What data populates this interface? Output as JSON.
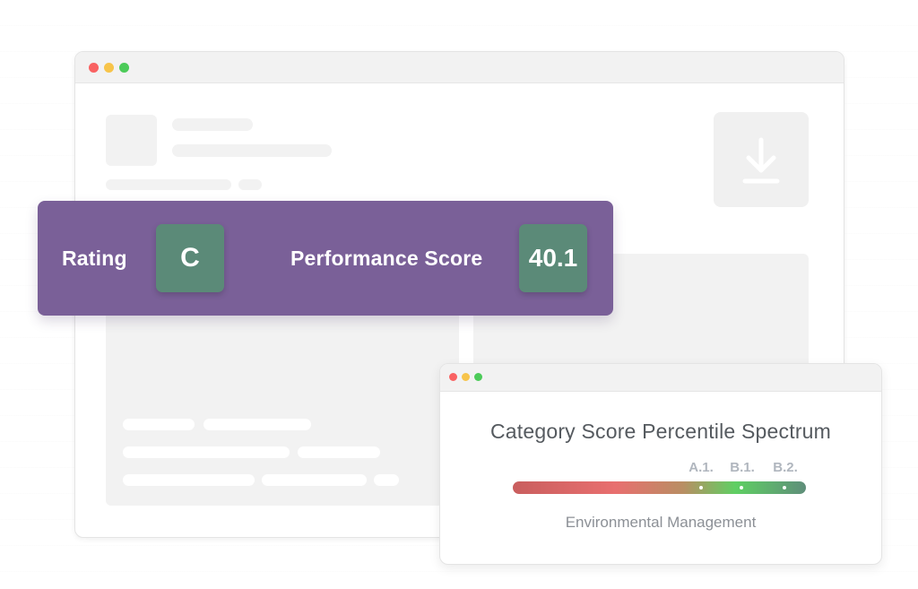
{
  "main_window": {
    "icons": {
      "download": "download-arrow-icon"
    }
  },
  "score_banner": {
    "rating_label": "Rating",
    "rating_value": "C",
    "performance_label": "Performance Score",
    "performance_value": "40.1",
    "colors": {
      "banner": "#7a6098",
      "tile": "#5b8a78"
    }
  },
  "spectrum_card": {
    "title": "Category Score Percentile Spectrum",
    "markers": [
      {
        "label": "A.1."
      },
      {
        "label": "B.1."
      },
      {
        "label": "B.2."
      }
    ],
    "caption": "Environmental Management",
    "gradient_colors": [
      "#c95e5e",
      "#e86f6f",
      "#b98e63",
      "#5fcf63",
      "#5f8e7a"
    ]
  }
}
